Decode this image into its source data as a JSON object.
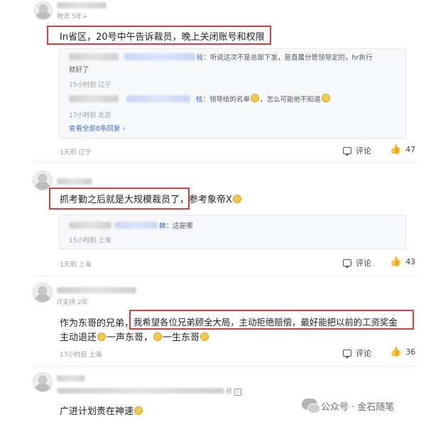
{
  "comments": [
    {
      "meta": "物流 5年+",
      "text": "In省区，20号中午告诉裁员，晚上关闭账号和权限",
      "replies": [
        {
          "name_tail": "枝",
          "text": "：听说这次不是总部下发，是直属分管领导定的，hr执行",
          "text2": "就好了",
          "meta": "15小时前 辽宁"
        },
        {
          "name_tail": "枝",
          "text": "：领导给的名单",
          "text_after": "，怎么可能他不知道",
          "meta": "17小时前 北京"
        }
      ],
      "view_all": "查看全部8条回复",
      "time": "1天前 辽宁",
      "comment_label": "评论",
      "likes": "47"
    },
    {
      "text_highlight": "抓考勤之后就是大规模裁员了，",
      "text_rest": "参考象帝X",
      "replies": [
        {
          "name_tail": "棘",
          "text": "：这是哪",
          "meta": "15小时前 上海"
        }
      ],
      "time": "1天前 上海",
      "comment_label": "评论",
      "likes": "43"
    },
    {
      "meta": "IT支持 2年",
      "text_pre": "作为东哥的兄弟，",
      "text_highlight": "我希望各位兄弟顾全大局，主动拒绝赔偿，最好能把以前的工资奖金",
      "text_line2_a": "主动退还",
      "text_line2_b": "一声东哥，",
      "text_line2_c": "一生东哥",
      "time": "17小时前 上海",
      "comment_label": "评论",
      "likes": "36"
    },
    {
      "meta_tail": "师",
      "text": "广进计划贵在神速"
    }
  ],
  "watermark": "公众号 · 金石随笔",
  "colors": {
    "highlight_border": "#e23b3b",
    "link": "#3a6fd8"
  }
}
